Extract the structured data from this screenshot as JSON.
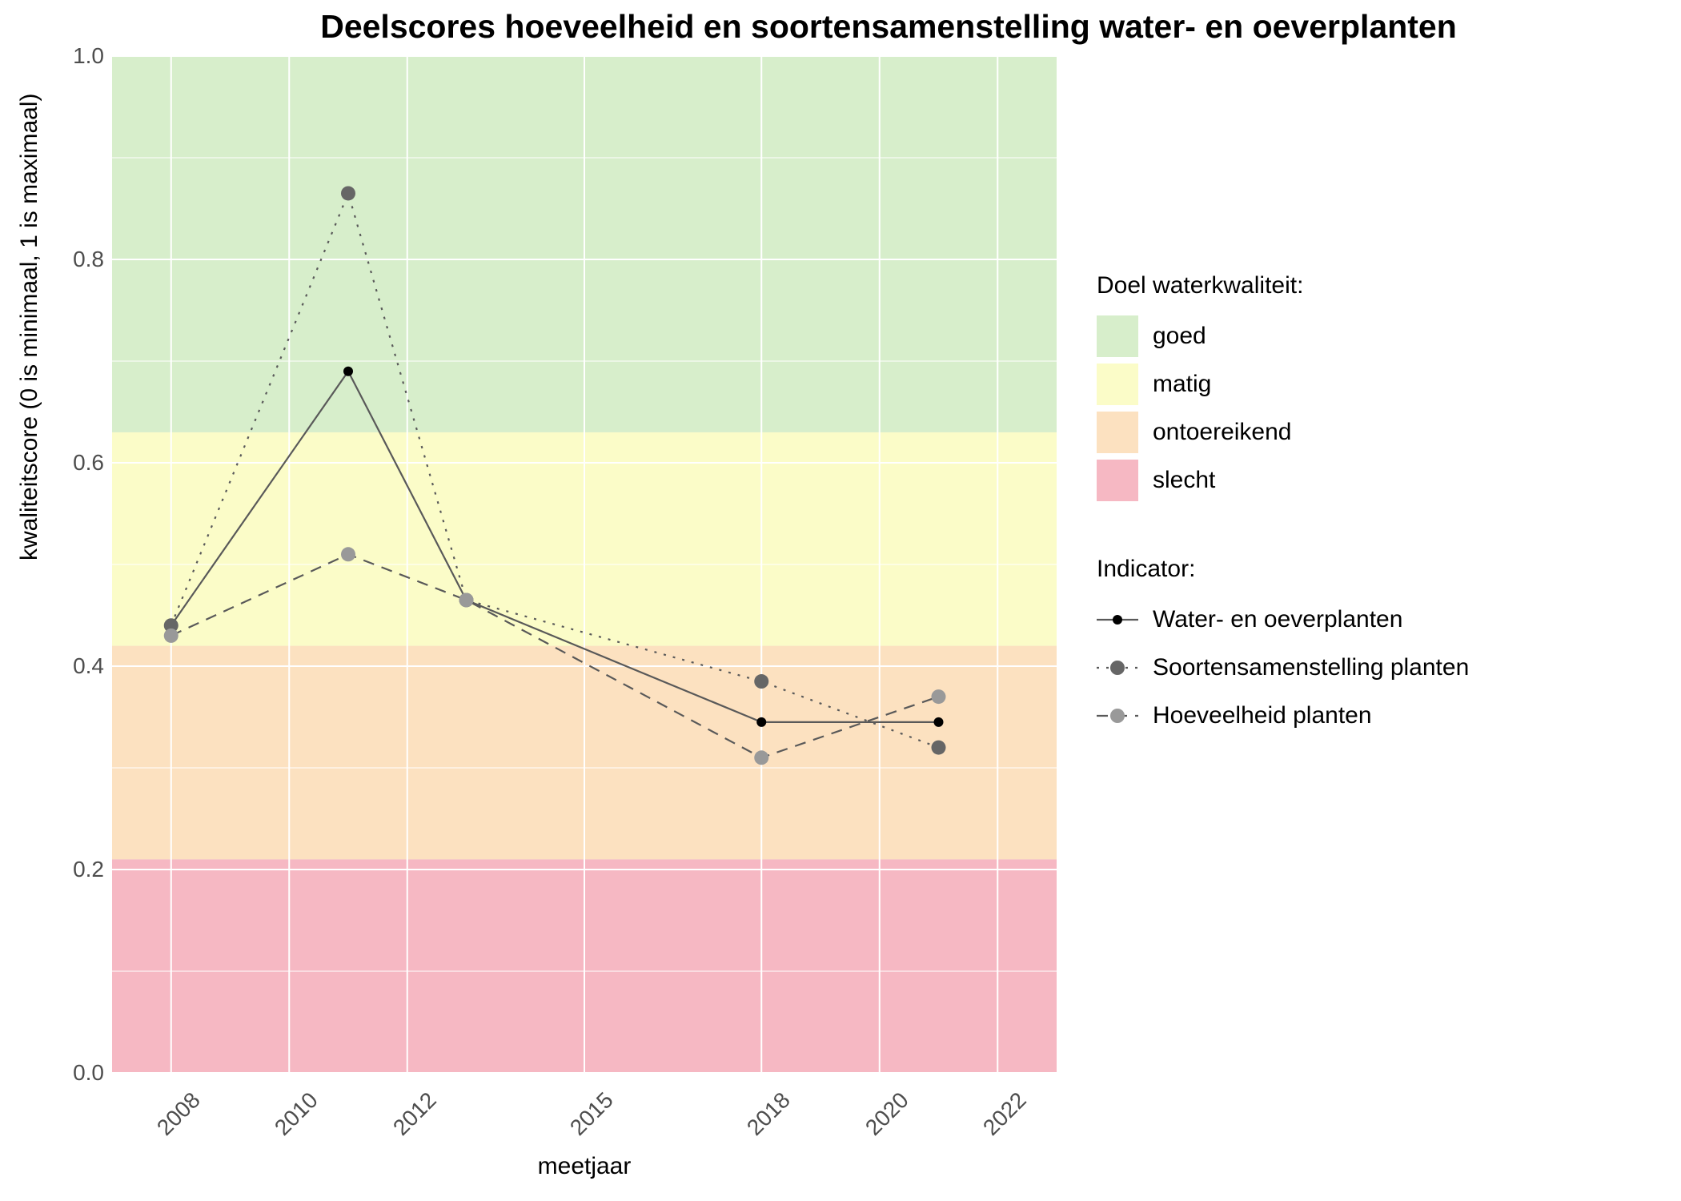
{
  "chart_data": {
    "type": "line",
    "title": "Deelscores hoeveelheid en soortensamenstelling water- en oeverplanten",
    "xlabel": "meetjaar",
    "ylabel": "kwaliteitscore (0 is minimaal, 1 is maximaal)",
    "x_ticks": [
      2008,
      2010,
      2012,
      2015,
      2018,
      2020,
      2022
    ],
    "y_ticks": [
      0.0,
      0.2,
      0.4,
      0.6,
      0.8,
      1.0
    ],
    "xlim": [
      2007,
      2023
    ],
    "ylim": [
      0.0,
      1.0
    ],
    "bands": [
      {
        "name": "slecht",
        "from": 0.0,
        "to": 0.21,
        "color": "#f6b8c3"
      },
      {
        "name": "ontoereikend",
        "from": 0.21,
        "to": 0.42,
        "color": "#fce1c0"
      },
      {
        "name": "matig",
        "from": 0.42,
        "to": 0.63,
        "color": "#fbfcc8"
      },
      {
        "name": "goed",
        "from": 0.63,
        "to": 1.0,
        "color": "#d7eecb"
      }
    ],
    "series": [
      {
        "name": "Water- en oeverplanten",
        "style": "solid",
        "marker_color": "#000000",
        "x": [
          2008,
          2011,
          2013,
          2018,
          2021
        ],
        "y": [
          0.44,
          0.69,
          0.465,
          0.345,
          0.345
        ]
      },
      {
        "name": "Soortensamenstelling planten",
        "style": "dotted",
        "marker_color": "#666666",
        "x": [
          2008,
          2011,
          2013,
          2018,
          2021
        ],
        "y": [
          0.44,
          0.865,
          0.465,
          0.385,
          0.32
        ]
      },
      {
        "name": "Hoeveelheid planten",
        "style": "dashed",
        "marker_color": "#999999",
        "x": [
          2008,
          2011,
          2013,
          2018,
          2021
        ],
        "y": [
          0.43,
          0.51,
          0.465,
          0.31,
          0.37
        ]
      }
    ],
    "legend_quality_title": "Doel waterkwaliteit:",
    "legend_indicator_title": "Indicator:",
    "quality_labels": {
      "goed": "goed",
      "matig": "matig",
      "ontoereikend": "ontoereikend",
      "slecht": "slecht"
    }
  }
}
